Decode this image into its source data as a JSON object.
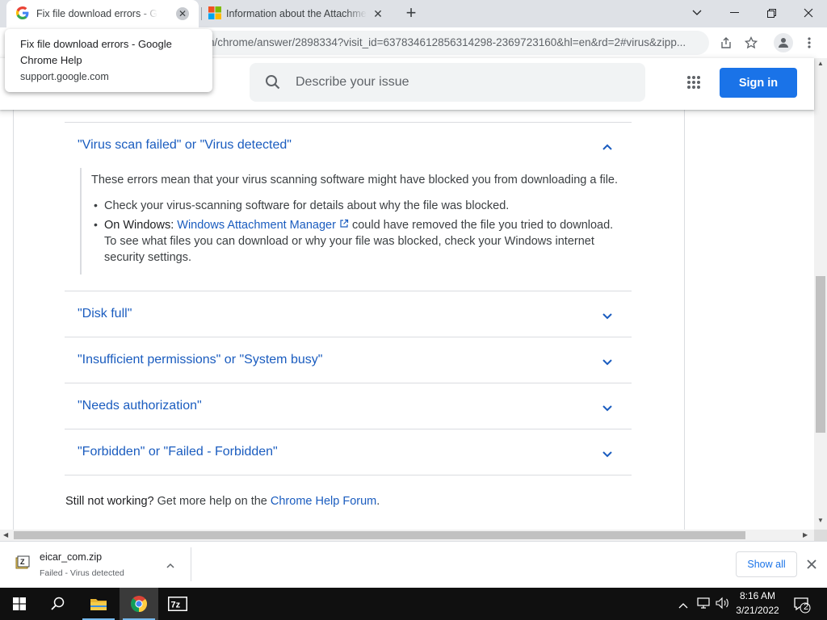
{
  "browser": {
    "tabs": [
      {
        "title": "Fix file download errors - Google Chrome Help",
        "active": true
      },
      {
        "title": "Information about the Attachment Manager",
        "active": false
      }
    ],
    "url": "n/chrome/answer/2898334?visit_id=637834612856314298-2369723160&hl=en&rd=2#virus&zipp...",
    "tooltip": {
      "title": "Fix file download errors - Google Chrome Help",
      "host": "support.google.com"
    }
  },
  "header": {
    "search_placeholder": "Describe your issue",
    "sign_in_label": "Sign in"
  },
  "article": {
    "sections": [
      {
        "title": "\"Virus scan failed\" or \"Virus detected\"",
        "expanded": true
      },
      {
        "title": "\"Disk full\"",
        "expanded": false
      },
      {
        "title": "\"Insufficient permissions\" or \"System busy\"",
        "expanded": false
      },
      {
        "title": "\"Needs authorization\"",
        "expanded": false
      },
      {
        "title": "\"Forbidden\" or \"Failed - Forbidden\"",
        "expanded": false
      }
    ],
    "intro": "These errors mean that your virus scanning software might have blocked you from downloading a file.",
    "bullet1": "Check your virus-scanning software for details about why the file was blocked.",
    "bullet2_prefix": "On Windows:",
    "bullet2_link": "Windows Attachment Manager",
    "bullet2_line1_rest": " could have removed the file you tried to download.",
    "bullet2_line2": "To see what files you can download or why your file was blocked, check your Windows internet",
    "bullet2_line3": "security settings.",
    "still_prefix": "Still not working?",
    "still_middle": " Get more help on the ",
    "still_link": "Chrome Help Forum",
    "still_end": "."
  },
  "download": {
    "filename": "eicar_com.zip",
    "status": "Failed - Virus detected",
    "show_all_label": "Show all"
  },
  "taskbar": {
    "time": "8:16 AM",
    "date": "3/21/2022",
    "notification_count": "2",
    "apps": [
      "file-explorer-icon",
      "chrome-icon",
      "7zip-icon"
    ]
  },
  "colors": {
    "link": "#1a5cbf",
    "accent": "#1a73e8"
  }
}
